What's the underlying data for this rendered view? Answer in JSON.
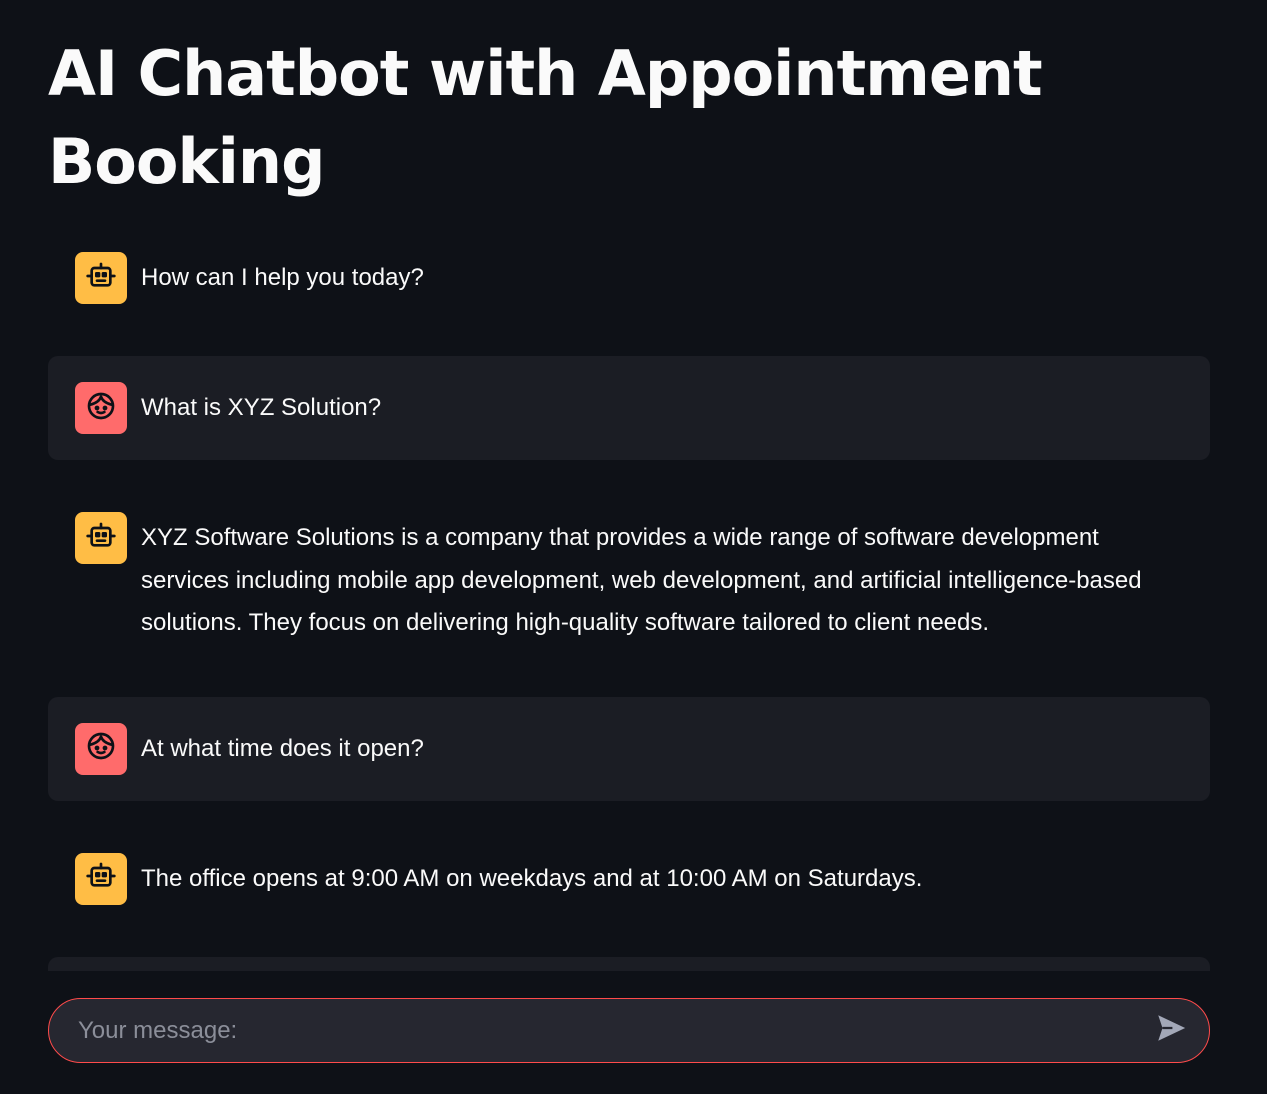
{
  "header": {
    "title": "AI Chatbot with Appointment Booking"
  },
  "messages": [
    {
      "role": "assistant",
      "avatar_icon": "robot-icon",
      "text": "How can I help you today?"
    },
    {
      "role": "user",
      "avatar_icon": "face-icon",
      "text": "What is XYZ Solution?"
    },
    {
      "role": "assistant",
      "avatar_icon": "robot-icon",
      "text": "XYZ Software Solutions is a company that provides a wide range of software development services including mobile app development, web development, and artificial intelligence-based solutions. They focus on delivering high-quality software tailored to client needs."
    },
    {
      "role": "user",
      "avatar_icon": "face-icon",
      "text": "At what time does it open?"
    },
    {
      "role": "assistant",
      "avatar_icon": "robot-icon",
      "text": "The office opens at 9:00 AM on weekdays and at 10:00 AM on Saturdays."
    }
  ],
  "chat_input": {
    "placeholder": "Your message:",
    "value": "",
    "send_icon": "send-icon"
  },
  "colors": {
    "background": "#0e1117",
    "user_bubble": "#1b1d24",
    "assistant_avatar": "#ffbd45",
    "user_avatar": "#ff6b6b",
    "input_border": "#ff4b4b"
  }
}
